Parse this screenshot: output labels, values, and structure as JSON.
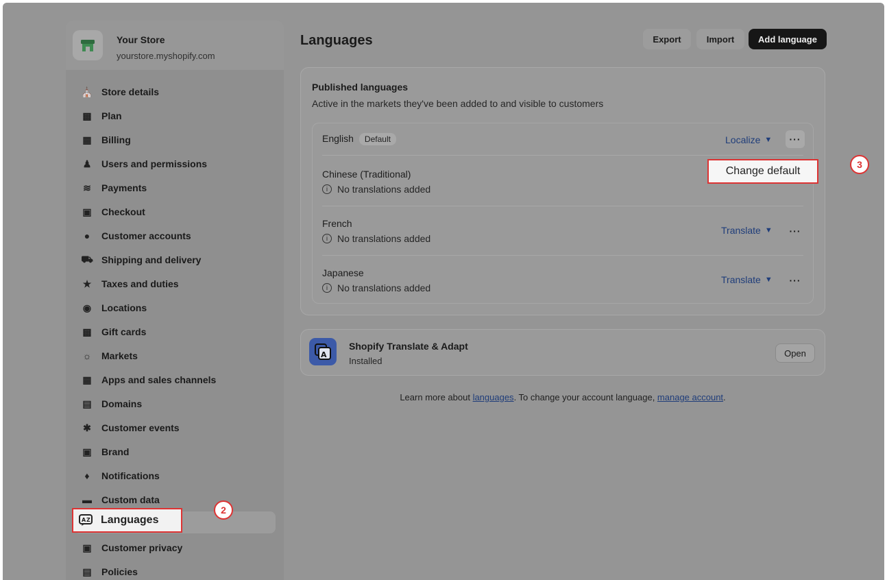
{
  "store": {
    "name": "Your Store",
    "url": "yourstore.myshopify.com"
  },
  "sidebar": {
    "items": [
      {
        "label": "Store details",
        "icon": "store-icon"
      },
      {
        "label": "Plan",
        "icon": "chart-icon"
      },
      {
        "label": "Billing",
        "icon": "receipt-icon"
      },
      {
        "label": "Users and permissions",
        "icon": "users-icon"
      },
      {
        "label": "Payments",
        "icon": "payments-icon"
      },
      {
        "label": "Checkout",
        "icon": "cart-icon"
      },
      {
        "label": "Customer accounts",
        "icon": "person-icon"
      },
      {
        "label": "Shipping and delivery",
        "icon": "truck-icon"
      },
      {
        "label": "Taxes and duties",
        "icon": "tax-icon"
      },
      {
        "label": "Locations",
        "icon": "pin-icon"
      },
      {
        "label": "Gift cards",
        "icon": "gift-card-icon"
      },
      {
        "label": "Markets",
        "icon": "globe-icon"
      },
      {
        "label": "Apps and sales channels",
        "icon": "apps-icon"
      },
      {
        "label": "Domains",
        "icon": "domain-icon"
      },
      {
        "label": "Customer events",
        "icon": "cursor-icon"
      },
      {
        "label": "Brand",
        "icon": "brand-icon"
      },
      {
        "label": "Notifications",
        "icon": "bell-icon"
      },
      {
        "label": "Custom data",
        "icon": "data-icon"
      },
      {
        "label": "Languages",
        "icon": "language-icon"
      },
      {
        "label": "Customer privacy",
        "icon": "lock-icon"
      },
      {
        "label": "Policies",
        "icon": "policy-icon"
      }
    ]
  },
  "annotations": {
    "step2": "2",
    "step3": "3"
  },
  "page": {
    "title": "Languages",
    "export_label": "Export",
    "import_label": "Import",
    "add_label": "Add language"
  },
  "published": {
    "title": "Published languages",
    "subtitle": "Active in the markets they've been added to and visible to customers",
    "languages": [
      {
        "name": "English",
        "badge": "Default",
        "action": "Localize",
        "note": ""
      },
      {
        "name": "Chinese (Traditional)",
        "badge": "",
        "action": "",
        "note": "No translations added"
      },
      {
        "name": "French",
        "badge": "",
        "action": "Translate",
        "note": "No translations added"
      },
      {
        "name": "Japanese",
        "badge": "",
        "action": "Translate",
        "note": "No translations added"
      }
    ],
    "menu_item": "Change default"
  },
  "app": {
    "name": "Shopify Translate & Adapt",
    "status": "Installed",
    "open_label": "Open"
  },
  "footer": {
    "prefix": "Learn more about ",
    "link1": "languages",
    "middle": ". To change your account language, ",
    "link2": "manage account",
    "suffix": "."
  }
}
